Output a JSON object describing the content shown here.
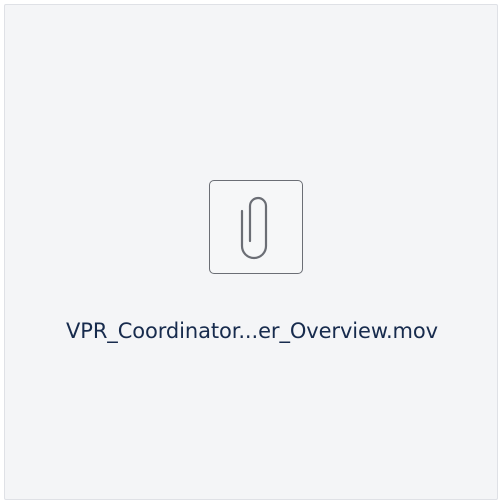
{
  "attachment": {
    "file_name": "VPR_Coordinator...er_Overview.mov",
    "icon": "paperclip-icon"
  }
}
